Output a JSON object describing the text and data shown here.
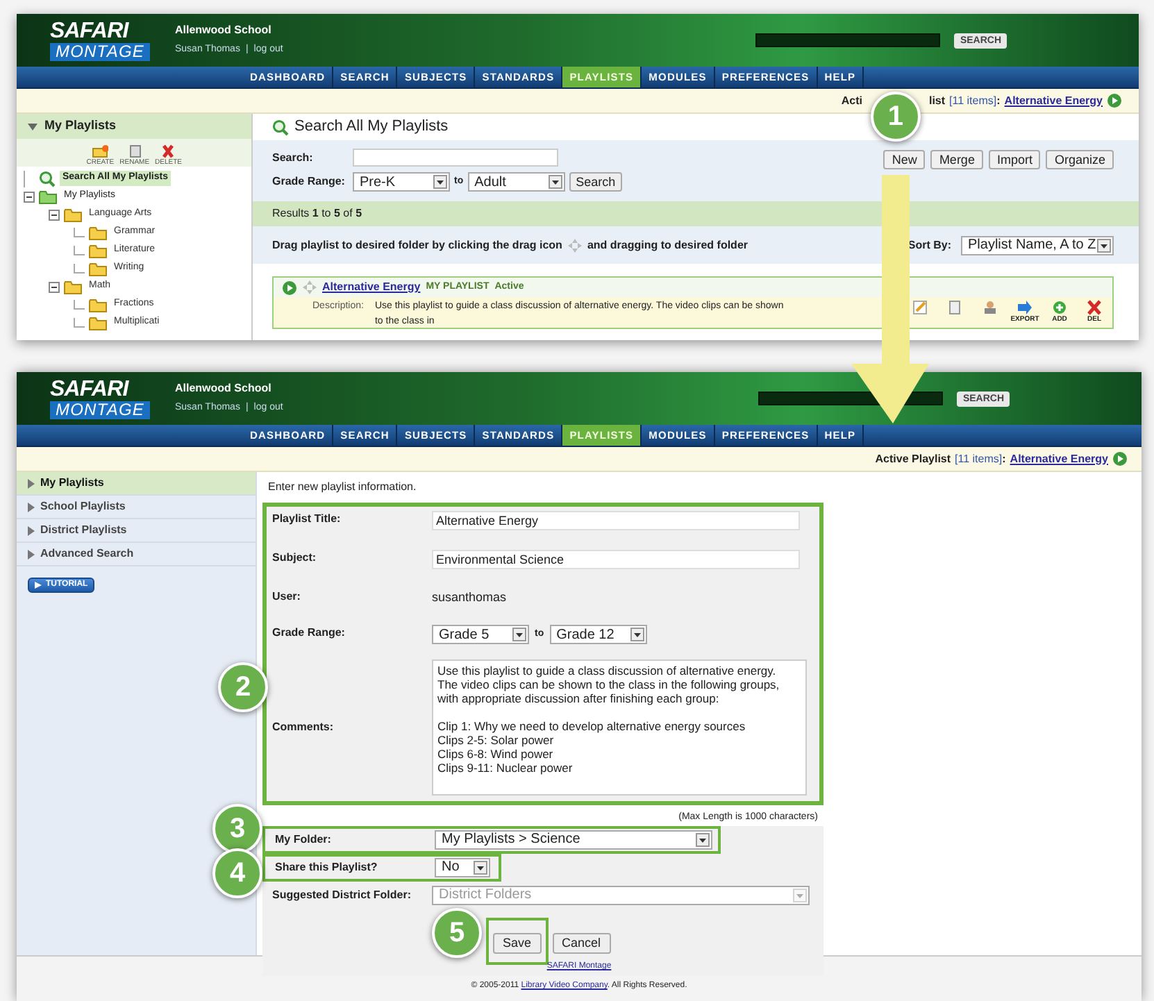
{
  "search_page": {
    "header": {
      "logo_top": "SAFARI",
      "logo_bottom": "MONTAGE",
      "school": "Allenwood School",
      "user": "Susan Thomas",
      "separator": "|",
      "logout": "log out",
      "search_button": "SEARCH"
    },
    "nav": [
      {
        "label": "DASHBOARD",
        "selected": false
      },
      {
        "label": "SEARCH",
        "selected": false
      },
      {
        "label": "SUBJECTS",
        "selected": false
      },
      {
        "label": "STANDARDS",
        "selected": false
      },
      {
        "label": "PLAYLISTS",
        "selected": true
      },
      {
        "label": "MODULES",
        "selected": false
      },
      {
        "label": "PREFERENCES",
        "selected": false
      },
      {
        "label": "HELP",
        "selected": false
      }
    ],
    "active_playlist": {
      "label_start": "Acti",
      "label_end": "list",
      "count": "[11 items]",
      "separator": ":",
      "name": "Alternative Energy"
    },
    "sidebar": {
      "title": "My Playlists",
      "expanded": true,
      "tools": [
        {
          "label": "CREATE",
          "kind": "create"
        },
        {
          "label": "RENAME",
          "kind": "rename"
        },
        {
          "label": "DELETE",
          "kind": "delete"
        }
      ],
      "tree": [
        {
          "label": "Search All My Playlists",
          "kind": "search",
          "selected": true
        },
        {
          "label": "My Playlists",
          "kind": "root",
          "selected": false,
          "expanded": true,
          "children": [
            {
              "label": "Language Arts",
              "kind": "folder",
              "selected": false,
              "expanded": true,
              "children": [
                {
                  "label": "Grammar",
                  "kind": "folder",
                  "selected": false
                },
                {
                  "label": "Literature",
                  "kind": "folder",
                  "selected": false
                },
                {
                  "label": "Writing",
                  "kind": "folder",
                  "selected": false
                }
              ]
            },
            {
              "label": "Math",
              "kind": "folder",
              "selected": false,
              "expanded": true,
              "children": [
                {
                  "label": "Fractions",
                  "kind": "folder",
                  "selected": false
                },
                {
                  "label": "Multiplicati",
                  "kind": "folder",
                  "selected": false
                }
              ]
            }
          ]
        }
      ]
    },
    "main": {
      "title": "Search All My Playlists",
      "search_label": "Search:",
      "grade_label": "Grade Range:",
      "grade_from": "Pre-K",
      "grade_joiner": "to",
      "grade_to": "Adult",
      "search_button": "Search",
      "actions": [
        "New",
        "Merge",
        "Import",
        "Organize"
      ],
      "results": "Results **1** to **5** of **5**",
      "drag_hint_before": "Drag playlist to desired folder by clicking the drag icon",
      "drag_hint_after": "and dragging to desired folder",
      "sort_label": "Sort By:",
      "sort_value": "Playlist Name, A to Z",
      "playlist": {
        "name": "Alternative Energy",
        "tag": "MY PLAYLIST",
        "status": "Active",
        "description_label": "Description:",
        "description": "Use this playlist to guide a class discussion of alternative energy. The video clips can be shown to the class in",
        "tools": [
          {
            "kind": "edit"
          },
          {
            "kind": "copy"
          },
          {
            "kind": "share"
          },
          {
            "kind": "export",
            "label": "EXPORT"
          },
          {
            "kind": "add",
            "label": "ADD"
          },
          {
            "kind": "delete",
            "label": "DEL"
          }
        ]
      }
    }
  },
  "new_playlist_page": {
    "header": {
      "logo_top": "SAFARI",
      "logo_bottom": "MONTAGE",
      "school": "Allenwood School",
      "user": "Susan Thomas",
      "separator": "|",
      "logout": "log out",
      "search_button": "SEARCH"
    },
    "nav": [
      {
        "label": "DASHBOARD",
        "selected": false
      },
      {
        "label": "SEARCH",
        "selected": false
      },
      {
        "label": "SUBJECTS",
        "selected": false
      },
      {
        "label": "STANDARDS",
        "selected": false
      },
      {
        "label": "PLAYLISTS",
        "selected": true
      },
      {
        "label": "MODULES",
        "selected": false
      },
      {
        "label": "PREFERENCES",
        "selected": false
      },
      {
        "label": "HELP",
        "selected": false
      }
    ],
    "active_playlist": {
      "label": "Active Playlist",
      "count": "[11 items]",
      "separator": ":",
      "name": "Alternative Energy"
    },
    "sidebar": {
      "items": [
        {
          "label": "My Playlists",
          "selected": true
        },
        {
          "label": "School Playlists",
          "selected": false
        },
        {
          "label": "District Playlists",
          "selected": false
        },
        {
          "label": "Advanced Search",
          "selected": false
        }
      ],
      "tutorial": "TUTORIAL"
    },
    "intro": "Enter new playlist information.",
    "fields": [
      {
        "label": "Playlist Title:",
        "kind": "text",
        "value": "Alternative Energy"
      },
      {
        "label": "Subject:",
        "kind": "text",
        "value": "Environmental Science"
      },
      {
        "label": "User:",
        "kind": "static",
        "value": "susanthomas"
      },
      {
        "label": "Grade Range:",
        "kind": "range",
        "from": "Grade 5",
        "joiner": "to",
        "to": "Grade 12"
      },
      {
        "label": "Comments:",
        "kind": "textarea",
        "paragraphs": [
          [
            "Use this playlist to guide a class discussion of alternative energy.",
            "The video clips can be shown to the class in the following groups,",
            "with appropriate discussion after finishing each group:"
          ],
          [
            "Clip 1: Why we need to develop alternative energy sources",
            "Clips 2-5: Solar power",
            "Clips 6-8: Wind power",
            "Clips 9-11: Nuclear power"
          ]
        ]
      }
    ],
    "max_length": "(Max Length is 1000 characters)",
    "options": [
      {
        "label": "My Folder:",
        "kind": "wide",
        "value": "My Playlists > Science",
        "disabled": false,
        "highlighted": true
      },
      {
        "label": "Share this Playlist?",
        "kind": "short",
        "value": "No",
        "disabled": false,
        "highlighted": true
      },
      {
        "label": "Suggested District Folder:",
        "kind": "wide",
        "value": "District Folders",
        "disabled": true,
        "highlighted": false
      }
    ],
    "buttons": [
      {
        "label": "Save",
        "highlighted": true
      },
      {
        "label": "Cancel",
        "highlighted": false
      }
    ],
    "footer": {
      "link": "SAFARI Montage",
      "copyright_before": "© 2005-2011 ",
      "copyright_link": "Library Video Company",
      "copyright_after": ". All Rights Reserved."
    }
  },
  "step_badges": [
    "1",
    "2",
    "3",
    "4",
    "5"
  ]
}
